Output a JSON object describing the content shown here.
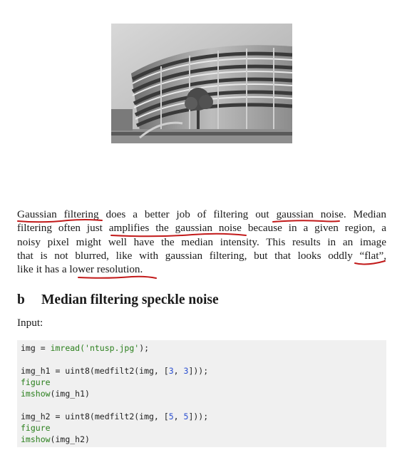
{
  "paragraph": {
    "lines": [
      {
        "parts": [
          "Gaussian filtering",
          " does a better job of filtering out ",
          "gaussian noise",
          ". Median"
        ]
      },
      {
        "parts": [
          "filtering often just ",
          "amplifies the gaussian noise",
          " because in a given region, a"
        ]
      },
      {
        "parts": [
          "noisy pixel might well have the median intensity. This results in an image"
        ]
      },
      {
        "parts": [
          "that is not blurred, like with gaussian filtering, but that looks oddly ",
          "“flat”",
          ","
        ]
      },
      {
        "parts": [
          "like it has a ",
          "lower resolution",
          "."
        ]
      }
    ]
  },
  "section": {
    "number": "b",
    "title": "Median filtering speckle noise"
  },
  "input_label": "Input:",
  "code": {
    "line1": {
      "var": "img",
      "eq": " = ",
      "fn": "imread(",
      "str": "'ntusp.jpg'",
      "end": ");"
    },
    "line2": {
      "text": "img_h1 = uint8(medfilt2(img, [",
      "n1": "3",
      "sep": ", ",
      "n2": "3",
      "end": "]));"
    },
    "line3": {
      "kw": "figure"
    },
    "line4": {
      "kw": "imshow",
      "rest": "(img_h1)"
    },
    "line5": {
      "text": "img_h2 = uint8(medfilt2(img, [",
      "n1": "5",
      "sep": ", ",
      "n2": "5",
      "end": "]));"
    },
    "line6": {
      "kw": "figure"
    },
    "line7": {
      "kw": "imshow",
      "rest": "(img_h2)"
    }
  },
  "colors": {
    "annotation_ink": "#c21a1a",
    "code_keyword": "#2a7f1c",
    "code_number": "#2b4fd1",
    "code_background": "#f0f0f0"
  }
}
